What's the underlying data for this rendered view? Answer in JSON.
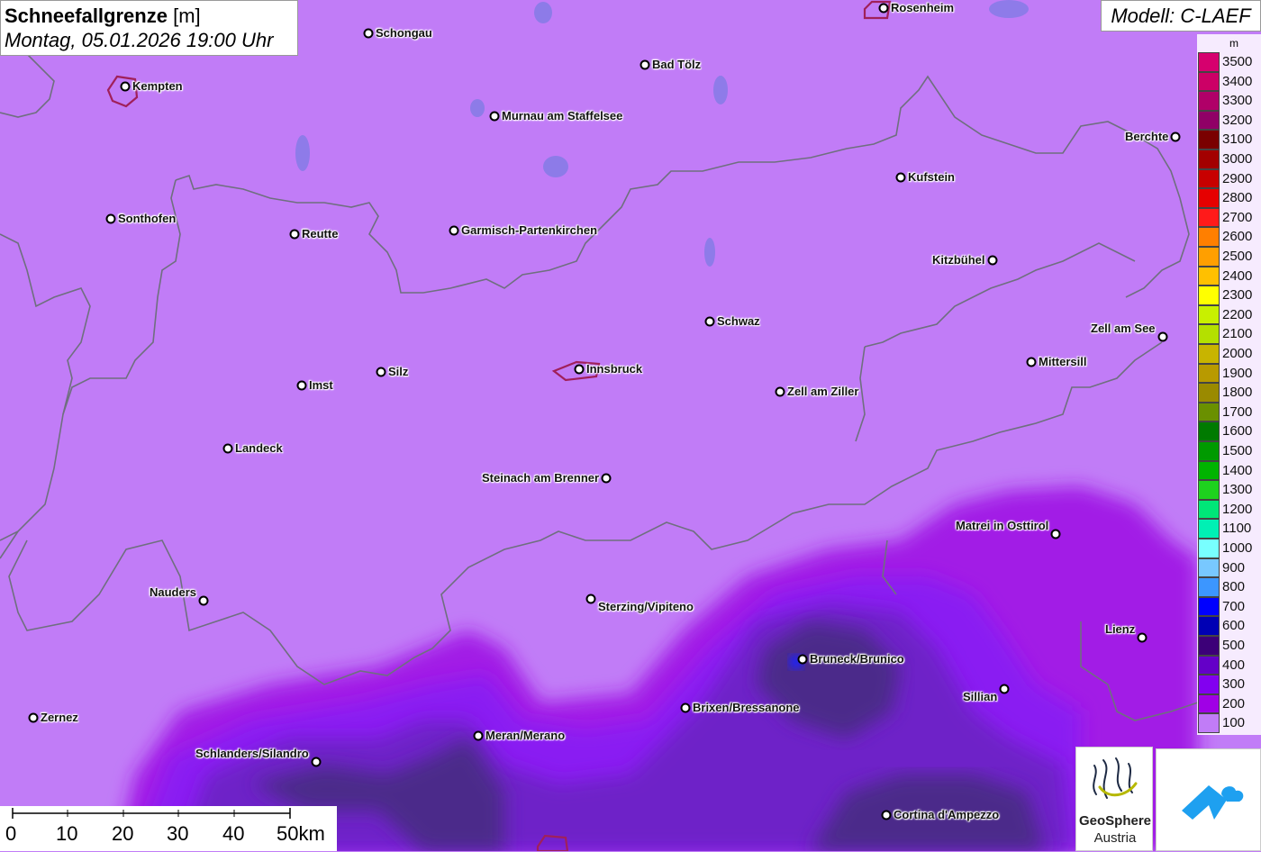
{
  "title": {
    "main": "Schneefallgrenze",
    "unit": "[m]",
    "datetime": "Montag, 05.01.2026 19:00 Uhr"
  },
  "model": "Modell: C-LAEF",
  "legend": {
    "unit": "m",
    "entries": [
      {
        "value": "3500",
        "color": "#d6006e"
      },
      {
        "value": "3400",
        "color": "#cc0066"
      },
      {
        "value": "3300",
        "color": "#b00068"
      },
      {
        "value": "3200",
        "color": "#900066"
      },
      {
        "value": "3100",
        "color": "#7a0000"
      },
      {
        "value": "3000",
        "color": "#a30000"
      },
      {
        "value": "2900",
        "color": "#c80000"
      },
      {
        "value": "2800",
        "color": "#e60000"
      },
      {
        "value": "2700",
        "color": "#ff1a1a"
      },
      {
        "value": "2600",
        "color": "#ff7f00"
      },
      {
        "value": "2500",
        "color": "#ff9f00"
      },
      {
        "value": "2400",
        "color": "#ffc000"
      },
      {
        "value": "2300",
        "color": "#ffff00"
      },
      {
        "value": "2200",
        "color": "#c8f000"
      },
      {
        "value": "2100",
        "color": "#b4e000"
      },
      {
        "value": "2000",
        "color": "#c8b400"
      },
      {
        "value": "1900",
        "color": "#b89a00"
      },
      {
        "value": "1800",
        "color": "#9a8a00"
      },
      {
        "value": "1700",
        "color": "#6a9000"
      },
      {
        "value": "1600",
        "color": "#007a00"
      },
      {
        "value": "1500",
        "color": "#009a00"
      },
      {
        "value": "1400",
        "color": "#00b400"
      },
      {
        "value": "1300",
        "color": "#1ed21e"
      },
      {
        "value": "1200",
        "color": "#00e678"
      },
      {
        "value": "1100",
        "color": "#00f0b4"
      },
      {
        "value": "1000",
        "color": "#78ffff"
      },
      {
        "value": "900",
        "color": "#78c8ff"
      },
      {
        "value": "800",
        "color": "#3c96ff"
      },
      {
        "value": "700",
        "color": "#0000ff"
      },
      {
        "value": "600",
        "color": "#0000b4"
      },
      {
        "value": "500",
        "color": "#3c0078"
      },
      {
        "value": "400",
        "color": "#6400c8"
      },
      {
        "value": "300",
        "color": "#8200f0"
      },
      {
        "value": "200",
        "color": "#a000e6"
      },
      {
        "value": "100",
        "color": "#c17cf7"
      }
    ]
  },
  "cities": [
    {
      "name": "Rosenheim",
      "id": "rosenheim"
    },
    {
      "name": "Schongau",
      "id": "schongau"
    },
    {
      "name": "Kempten",
      "id": "kempten"
    },
    {
      "name": "Bad Tölz",
      "id": "bad-toelz"
    },
    {
      "name": "Murnau am Staffelsee",
      "id": "murnau"
    },
    {
      "name": "Berchte",
      "id": "berchtesgaden"
    },
    {
      "name": "Kufstein",
      "id": "kufstein"
    },
    {
      "name": "Sonthofen",
      "id": "sonthofen"
    },
    {
      "name": "Reutte",
      "id": "reutte"
    },
    {
      "name": "Garmisch-Partenkirchen",
      "id": "garmisch"
    },
    {
      "name": "Kitzbühel",
      "id": "kitzbuehel"
    },
    {
      "name": "Schwaz",
      "id": "schwaz"
    },
    {
      "name": "Zell am See",
      "id": "zell-am-see"
    },
    {
      "name": "Mittersill",
      "id": "mittersill"
    },
    {
      "name": "Silz",
      "id": "silz"
    },
    {
      "name": "Innsbruck",
      "id": "innsbruck"
    },
    {
      "name": "Imst",
      "id": "imst"
    },
    {
      "name": "Zell am Ziller",
      "id": "zell-am-ziller"
    },
    {
      "name": "Landeck",
      "id": "landeck"
    },
    {
      "name": "Steinach am Brenner",
      "id": "steinach"
    },
    {
      "name": "Matrei in Osttirol",
      "id": "matrei"
    },
    {
      "name": "Nauders",
      "id": "nauders"
    },
    {
      "name": "Sterzing/Vipiteno",
      "id": "sterzing"
    },
    {
      "name": "Lienz",
      "id": "lienz"
    },
    {
      "name": "Bruneck/Brunico",
      "id": "bruneck"
    },
    {
      "name": "Sillian",
      "id": "sillian"
    },
    {
      "name": "Brixen/Bressanone",
      "id": "brixen"
    },
    {
      "name": "Zernez",
      "id": "zernez"
    },
    {
      "name": "Meran/Merano",
      "id": "meran"
    },
    {
      "name": "Schlanders/Silandro",
      "id": "schlanders"
    },
    {
      "name": "Cortina d'Ampezzo",
      "id": "cortina"
    }
  ],
  "scale": {
    "ticks": [
      "0",
      "10",
      "20",
      "30",
      "40",
      "50km"
    ]
  },
  "logos": {
    "geosphere_name": "GeoSphere",
    "geosphere_sub": "Austria"
  }
}
